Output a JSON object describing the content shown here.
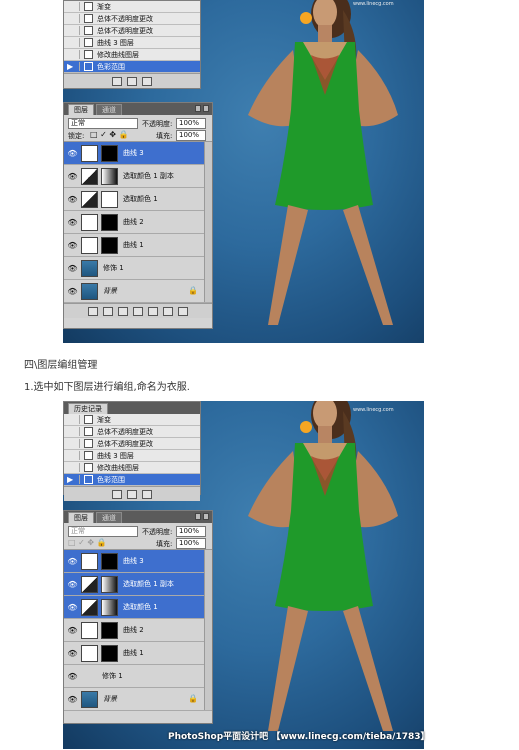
{
  "section": {
    "heading": "四\\图层编组管理",
    "instruction": "1.选中如下图层进行编组,命名为衣服."
  },
  "history_panel_top": {
    "items": [
      "渐变",
      "总体不透明度更改",
      "总体不透明度更改",
      "曲线 3 图层",
      "修改曲线图层",
      "色彩范围"
    ]
  },
  "layers_panel_top": {
    "tabs": [
      "图层",
      "通道"
    ],
    "blend_mode": "正常",
    "opacity_label": "不透明度:",
    "opacity_value": "100%",
    "lock_label": "锁定:",
    "fill_label": "填充:",
    "fill_value": "100%",
    "layers": [
      "曲线 3",
      "选取颜色 1 副本",
      "选取颜色 1",
      "曲线 2",
      "曲线 1",
      "修饰 1",
      "背景"
    ]
  },
  "history_panel_bottom": {
    "tabs": [
      "历史记录"
    ],
    "items": [
      "渐变",
      "总体不透明度更改",
      "总体不透明度更改",
      "曲线 3 图层",
      "修改曲线图层",
      "色彩范围"
    ]
  },
  "layers_panel_bottom": {
    "tabs": [
      "图层",
      "通道"
    ],
    "blend_mode": "正常",
    "opacity_label": "不透明度:",
    "opacity_value": "100%",
    "fill_label": "填充:",
    "fill_value": "100%",
    "layers": [
      "曲线 3",
      "选取颜色 1 副本",
      "选取颜色 1",
      "曲线 2",
      "曲线 1",
      "修饰 1",
      "背景"
    ]
  },
  "watermark": {
    "main": "PhotoShop平面设计吧 【www.linecg.com/tieba/1783】",
    "small": "www.linecg.com"
  },
  "colors": {
    "selection": "#3e6fce",
    "panel": "#d4d4d4",
    "dress": "#1f9a2a"
  }
}
